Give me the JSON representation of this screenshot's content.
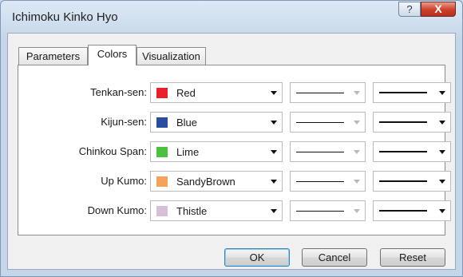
{
  "window": {
    "title": "Ichimoku Kinko Hyo",
    "help_label": "?",
    "close_label": "X"
  },
  "tabs": [
    {
      "label": "Parameters"
    },
    {
      "label": "Colors"
    },
    {
      "label": "Visualization"
    }
  ],
  "rows": [
    {
      "label": "Tenkan-sen:",
      "color_name": "Red",
      "color_hex": "#e8212a"
    },
    {
      "label": "Kijun-sen:",
      "color_name": "Blue",
      "color_hex": "#2a4da0"
    },
    {
      "label": "Chinkou Span:",
      "color_name": "Lime",
      "color_hex": "#4cc13f"
    },
    {
      "label": "Up Kumo:",
      "color_name": "SandyBrown",
      "color_hex": "#f5a35c"
    },
    {
      "label": "Down Kumo:",
      "color_name": "Thistle",
      "color_hex": "#d8bfd8"
    }
  ],
  "buttons": {
    "ok": "OK",
    "cancel": "Cancel",
    "reset": "Reset"
  }
}
